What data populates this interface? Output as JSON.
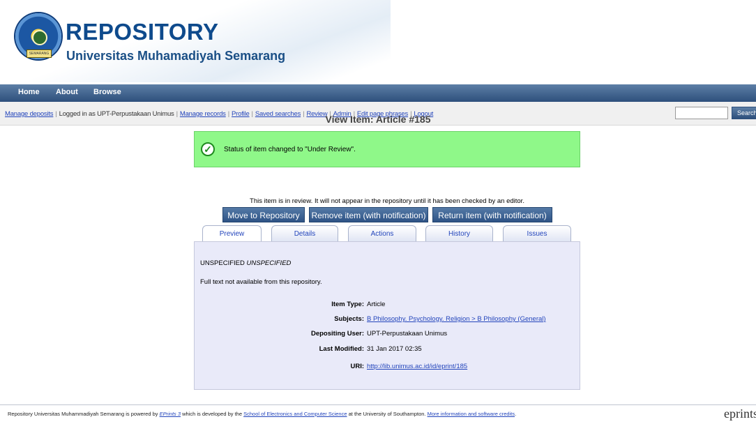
{
  "header": {
    "title": "REPOSITORY",
    "subtitle": "Universitas Muhamadiyah Semarang",
    "logo_icon": "university-seal-logo"
  },
  "nav": {
    "items": [
      "Home",
      "About",
      "Browse"
    ]
  },
  "userbar": {
    "manage_deposits": "Manage deposits",
    "logged_in": "Logged in as UPT-Perpustakaan Unimus",
    "manage_records": "Manage records",
    "profile": "Profile",
    "saved_searches": "Saved searches",
    "review": "Review",
    "admin": "Admin",
    "edit_phrases": "Edit page phrases",
    "logout": "Logout",
    "search_value": "",
    "search_button": "Search"
  },
  "page": {
    "title": "View Item: Article #185"
  },
  "message": {
    "text": "Status of item changed to \"Under Review\".",
    "icon": "check-circle-icon"
  },
  "review_note": "This item is in review. It will not appear in the repository until it has been checked by an editor.",
  "actions": {
    "move": "Move to Repository",
    "remove": "Remove item (with notification)",
    "return": "Return item (with notification)"
  },
  "tabs": [
    "Preview",
    "Details",
    "Actions",
    "History",
    "Issues"
  ],
  "preview": {
    "author_plain": "UNSPECIFIED",
    "author_italic": "UNSPECIFIED",
    "fulltext": "Full text not available from this repository.",
    "fields": [
      {
        "key": "Item Type:",
        "value": "Article"
      },
      {
        "key": "Subjects:",
        "value": "B Philosophy. Psychology. Religion > B Philosophy (General)"
      },
      {
        "key": "Depositing User:",
        "value": "UPT-Perpustakaan Unimus"
      },
      {
        "key": "Last Modified:",
        "value": "31 Jan 2017 02:35"
      },
      {
        "key": "URI:",
        "value": "http://lib.unimus.ac.id/id/eprint/185"
      }
    ]
  },
  "footer": {
    "t1": "Repository Universitas Muhammadiyah Semarang is powered by ",
    "l1": "EPrints 3",
    "t2": " which is developed by the ",
    "l2": "School of Electronics and Computer Science",
    "t3": " at the University of Southampton. ",
    "l3": "More information and software credits",
    "t4": ".",
    "brand": "eprints"
  }
}
